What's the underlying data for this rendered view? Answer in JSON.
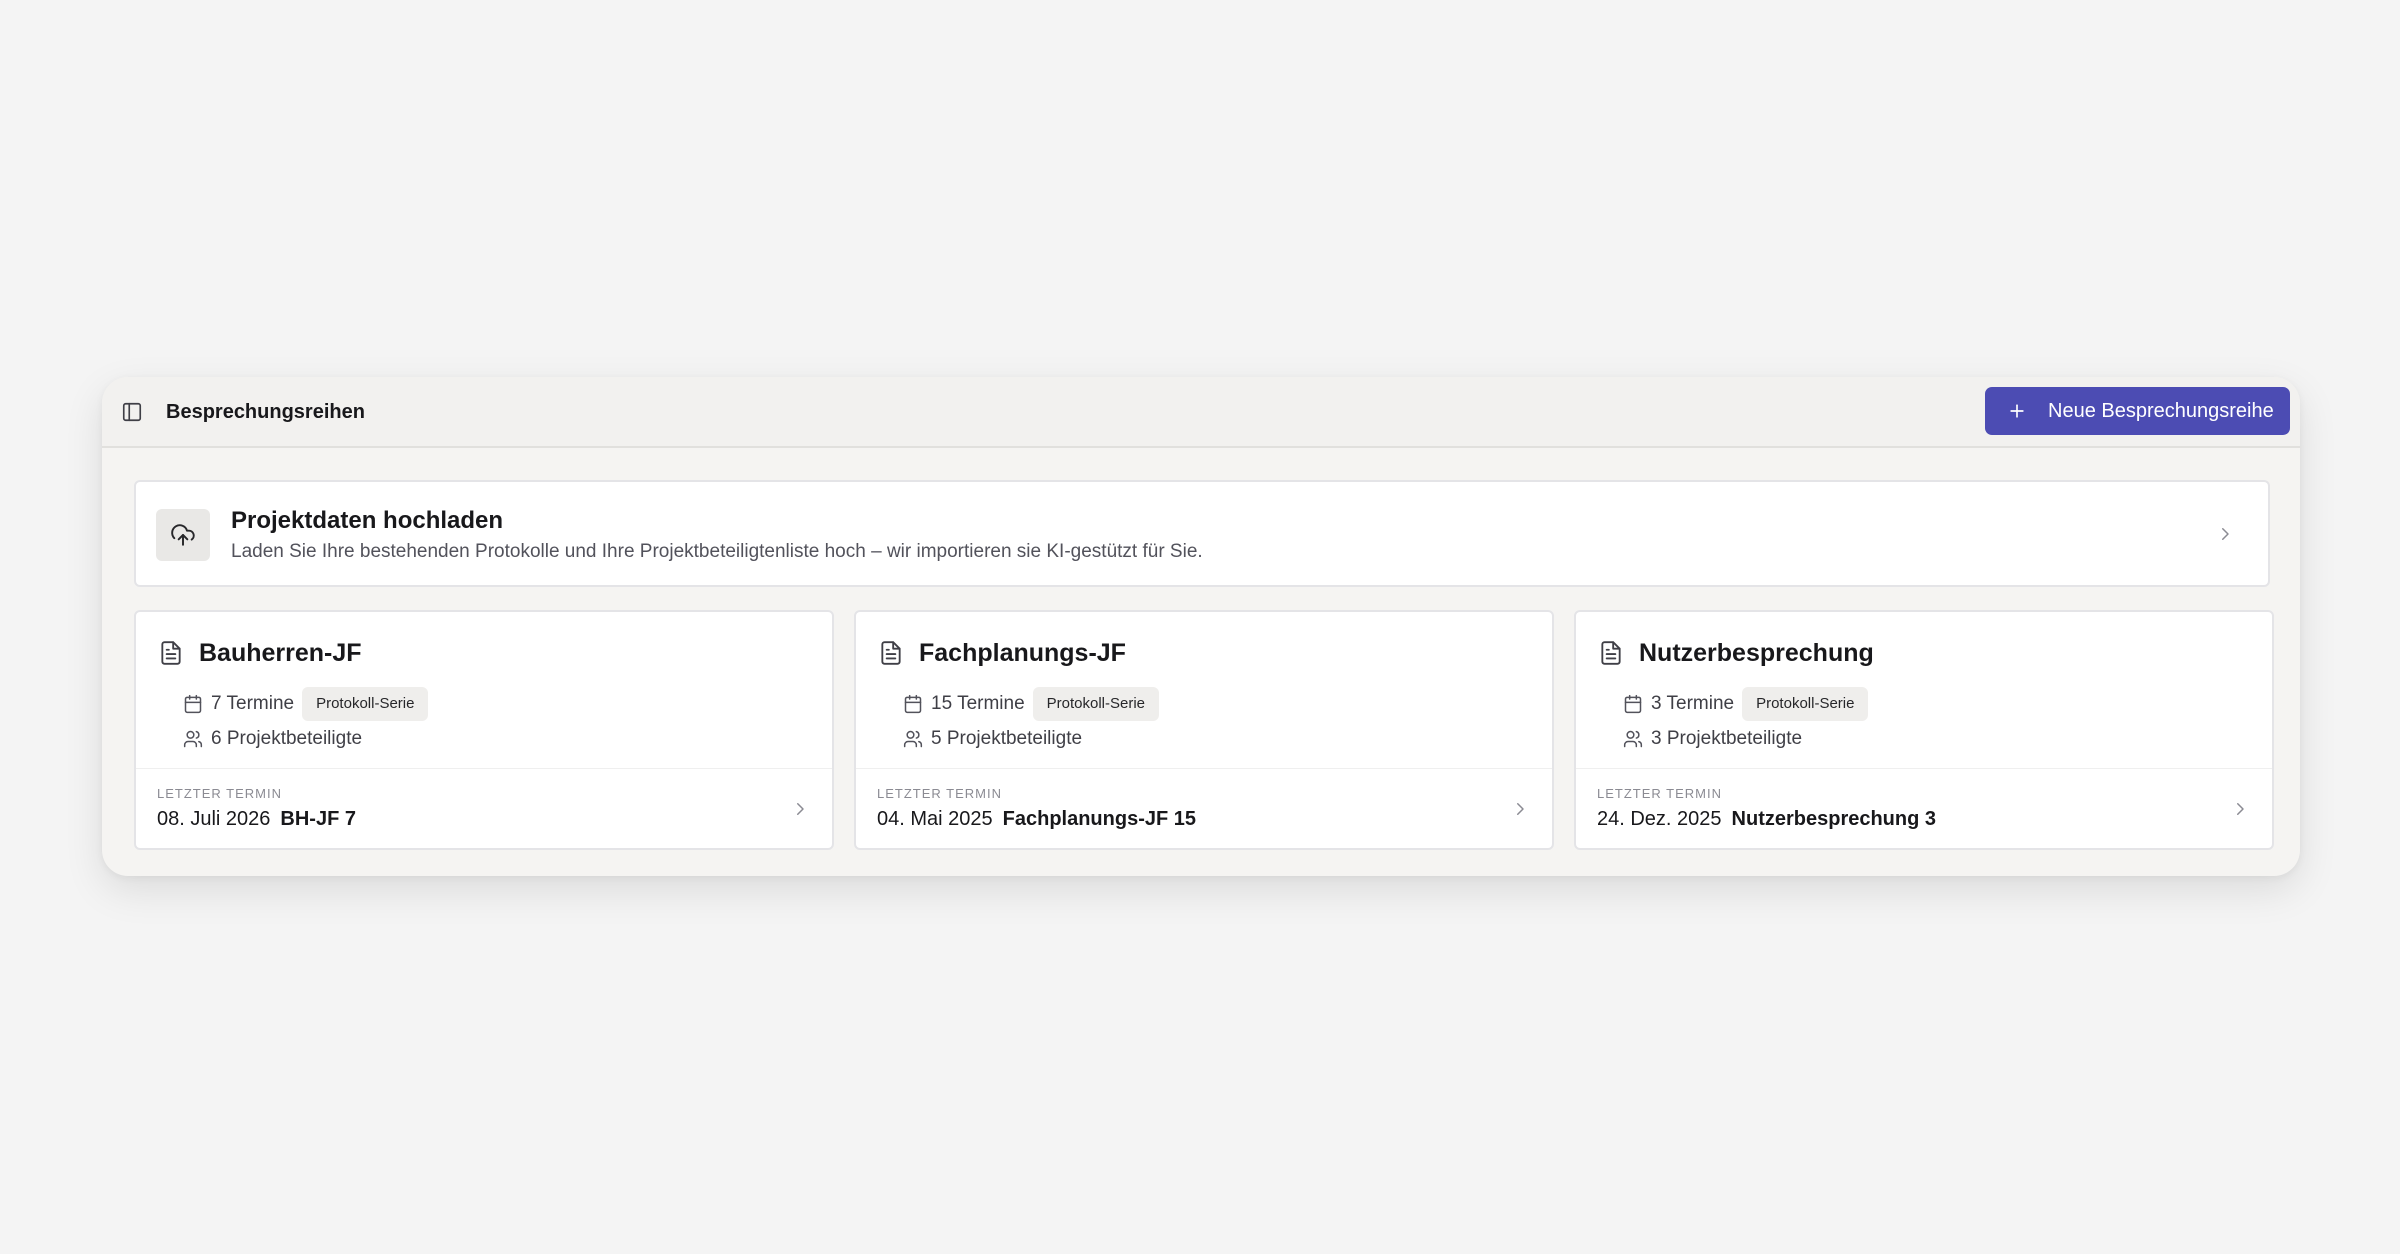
{
  "header": {
    "title": "Besprechungsreihen",
    "new_button_label": "Neue Besprechungsreihe"
  },
  "upload": {
    "title": "Projektdaten hochladen",
    "description": "Laden Sie Ihre bestehenden Protokolle und Ihre Projektbeteiligtenliste hoch – wir importieren sie KI-gestützt für Sie."
  },
  "series": [
    {
      "name": "Bauherren-JF",
      "termine": "7 Termine",
      "badge": "Protokoll-Serie",
      "beteiligte": "6 Projektbeteiligte",
      "last_label": "LETZTER TERMIN",
      "last_date": "08. Juli 2026",
      "last_name": "BH-JF 7"
    },
    {
      "name": "Fachplanungs-JF",
      "termine": "15 Termine",
      "badge": "Protokoll-Serie",
      "beteiligte": "5 Projektbeteiligte",
      "last_label": "LETZTER TERMIN",
      "last_date": "04. Mai 2025",
      "last_name": "Fachplanungs-JF 15"
    },
    {
      "name": "Nutzerbesprechung",
      "termine": "3 Termine",
      "badge": "Protokoll-Serie",
      "beteiligte": "3 Projektbeteiligte",
      "last_label": "LETZTER TERMIN",
      "last_date": "24. Dez. 2025",
      "last_name": "Nutzerbesprechung 3"
    }
  ],
  "icons": {
    "sidebar_toggle": "sidebar-panel-icon",
    "new": "plus-icon",
    "upload": "cloud-upload-icon",
    "series": "file-text-icon",
    "termine": "calendar-icon",
    "beteiligte": "users-icon",
    "navigate": "chevron-right-icon"
  },
  "colors": {
    "accent": "#4c4cb3",
    "background": "#f4f4f4",
    "panel": "#f5f4f2",
    "card": "#ffffff",
    "badge": "#efeeec"
  }
}
